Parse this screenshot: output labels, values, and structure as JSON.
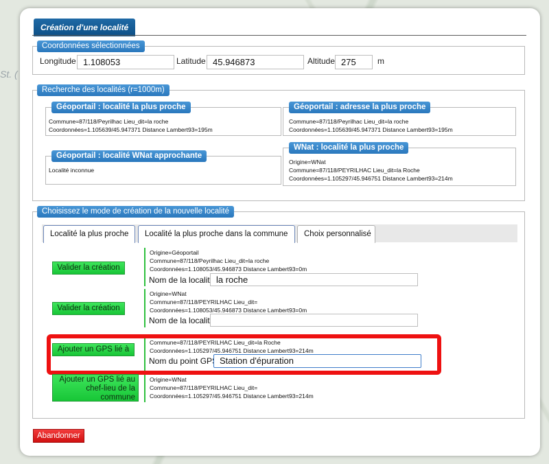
{
  "dialog": {
    "title": "Création d'une localité"
  },
  "coords": {
    "legend": "Coordonnées sélectionnées",
    "longitude_label": "Longitude",
    "longitude_value": "1.108053",
    "latitude_label": "Latitude",
    "latitude_value": "45.946873",
    "altitude_label": "Altitude",
    "altitude_value": "275",
    "altitude_unit": "m"
  },
  "search": {
    "legend": "Recherche des localités (r=1000m)",
    "boxes": [
      {
        "title": "Géoportail : localité la plus proche",
        "lines": [
          "Commune=87/118/Peyrilhac  Lieu_dit=la roche",
          "Coordonnées=1.105639/45.947371  Distance Lambert93=195m"
        ]
      },
      {
        "title": "Géoportail : adresse la plus proche",
        "lines": [
          "Commune=87/118/Peyrilhac  Lieu_dit=la roche",
          "Coordonnées=1.105639/45.947371  Distance Lambert93=195m"
        ]
      },
      {
        "title": "Géoportail : localité WNat approchante",
        "lines": [
          "Localité inconnue"
        ]
      },
      {
        "title": "WNat : localité la plus proche",
        "lines": [
          "Origine=WNat",
          "Commune=87/118/PEYRILHAC  Lieu_dit=la Roche",
          "Coordonnées=1.105297/45.946751  Distance Lambert93=214m"
        ]
      }
    ]
  },
  "mode": {
    "legend": "Choisissez le mode de création de la nouvelle localité",
    "tabs": [
      "Localité la plus proche",
      "Localité la plus proche dans la commune",
      "Choix personnalisé"
    ],
    "options": [
      {
        "button": "Valider la création",
        "lines": [
          "Origine=Géoportail",
          "Commune=87/118/Peyrilhac  Lieu_dit=la roche",
          "Coordonnées=1.108053/45.946873  Distance Lambert93=0m"
        ],
        "field_label": "Nom de la localité",
        "field_value": "la roche"
      },
      {
        "button": "Valider la création",
        "lines": [
          "Origine=WNat",
          "Commune=87/118/PEYRILHAC  Lieu_dit=",
          "Coordonnées=1.108053/45.946873  Distance Lambert93=0m"
        ],
        "field_label": "Nom de la localité",
        "field_value": ""
      },
      {
        "button": "Ajouter un GPS lié à",
        "lines": [
          "Commune=87/118/PEYRILHAC  Lieu_dit=la Roche",
          "Coordonnées=1.105297/45.946751  Distance Lambert93=214m"
        ],
        "field_label": "Nom du point GPS",
        "field_value": "Station d'épuration"
      },
      {
        "button": "Ajouter un GPS lié au chef-lieu de la commune",
        "lines": [
          "Origine=WNat",
          "Commune=87/118/PEYRILHAC  Lieu_dit=",
          "Coordonnées=1.105297/45.946751  Distance Lambert93=214m"
        ]
      }
    ]
  },
  "footer": {
    "cancel": "Abandonner"
  },
  "colors": {
    "title_bg": "#0d4f86",
    "legend_bg": "#2a78bd",
    "green_button": "#18c637",
    "cancel_button": "#d11010",
    "highlight": "#ee1111"
  }
}
